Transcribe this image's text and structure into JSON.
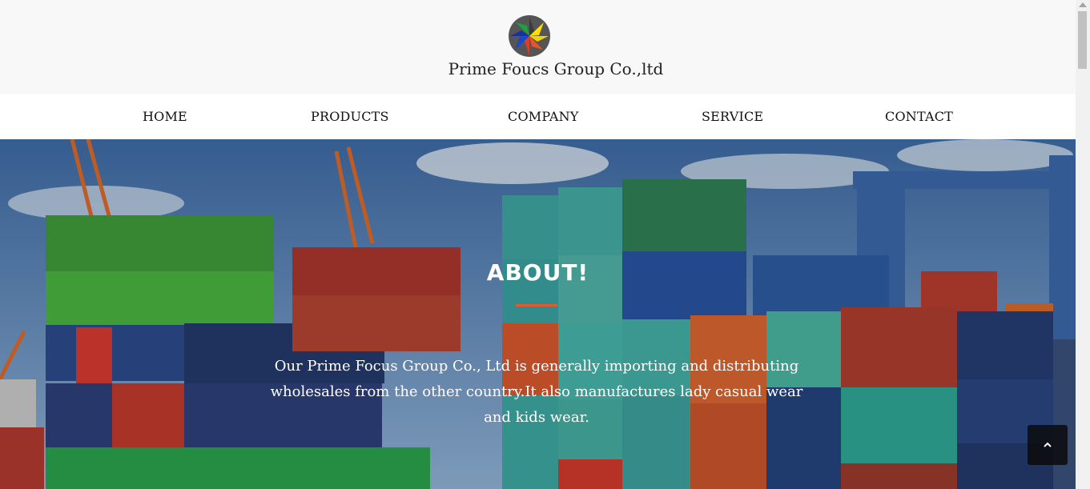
{
  "brand": {
    "name": "Prime Foucs Group Co.,ltd",
    "logo_icon": "pinwheel-star-logo"
  },
  "nav": {
    "items": [
      {
        "label": "HOME"
      },
      {
        "label": "PRODUCTS"
      },
      {
        "label": "COMPANY"
      },
      {
        "label": "SERVICE"
      },
      {
        "label": "CONTACT"
      }
    ]
  },
  "about": {
    "title": "ABOUT!",
    "text": "Our Prime Focus Group Co., Ltd is generally importing and distributing wholesales from the other country.It also manufactures lady casual wear and kids wear.",
    "accent_color": "#e25b2f"
  },
  "controls": {
    "back_to_top_icon": "chevron-up-icon"
  }
}
